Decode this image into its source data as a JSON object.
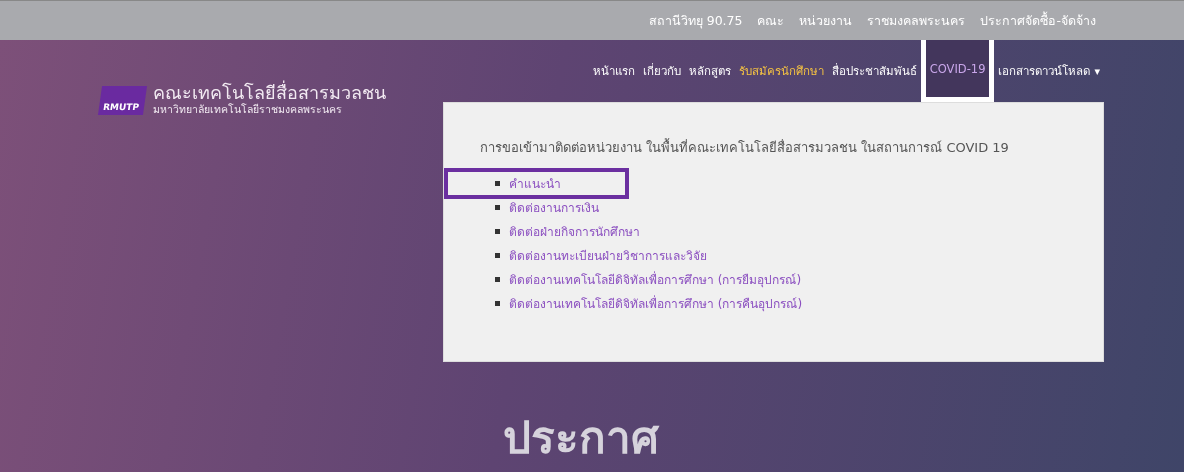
{
  "top_bar": {
    "links": [
      "สถานีวิทยุ 90.75",
      "คณะ",
      "หน่วยงาน",
      "ราชมงคลพระนคร",
      "ประกาศจัดซื้อ-จัดจ้าง"
    ]
  },
  "logo": {
    "badge": "RMUTP",
    "title": "คณะเทคโนโลยีสื่อสารมวลชน",
    "subtitle": "มหาวิทยาลัยเทคโนโลยีราชมงคลพระนคร"
  },
  "nav": {
    "items": [
      {
        "label": "หน้าแรก",
        "accent": false,
        "selected": false,
        "highlighted": false
      },
      {
        "label": "เกี่ยวกับ",
        "accent": false,
        "selected": false,
        "highlighted": false
      },
      {
        "label": "หลักสูตร",
        "accent": false,
        "selected": false,
        "highlighted": false
      },
      {
        "label": "รับสมัครนักศึกษา",
        "accent": true,
        "selected": false,
        "highlighted": false
      },
      {
        "label": "สื่อประชาสัมพันธ์",
        "accent": false,
        "selected": false,
        "highlighted": false
      },
      {
        "label": "COVID-19",
        "accent": false,
        "selected": true,
        "highlighted": true
      },
      {
        "label": "เอกสารดาวน์โหลด",
        "accent": false,
        "selected": false,
        "highlighted": false,
        "caret": "▾"
      }
    ]
  },
  "dropdown": {
    "heading": "การขอเข้ามาติดต่อหน่วยงาน ในพื้นที่คณะเทคโนโลยีสื่อสารมวลชน ในสถานการณ์ COVID 19",
    "items": [
      {
        "label": "คำแนะนำ",
        "highlighted": true
      },
      {
        "label": "ติดต่องานการเงิน",
        "highlighted": false
      },
      {
        "label": "ติดต่อฝ่ายกิจการนักศึกษา",
        "highlighted": false
      },
      {
        "label": "ติดต่องานทะเบียนฝ่ายวิชาการและวิจัย",
        "highlighted": false
      },
      {
        "label": "ติดต่องานเทคโนโลยีดิจิทัลเพื่อการศึกษา (การยืมอุปกรณ์)",
        "highlighted": false
      },
      {
        "label": "ติดต่องานเทคโนโลยีดิจิทัลเพื่อการศึกษา (การคืนอุปกรณ์)",
        "highlighted": false
      }
    ]
  },
  "headline": "ประกาศ"
}
